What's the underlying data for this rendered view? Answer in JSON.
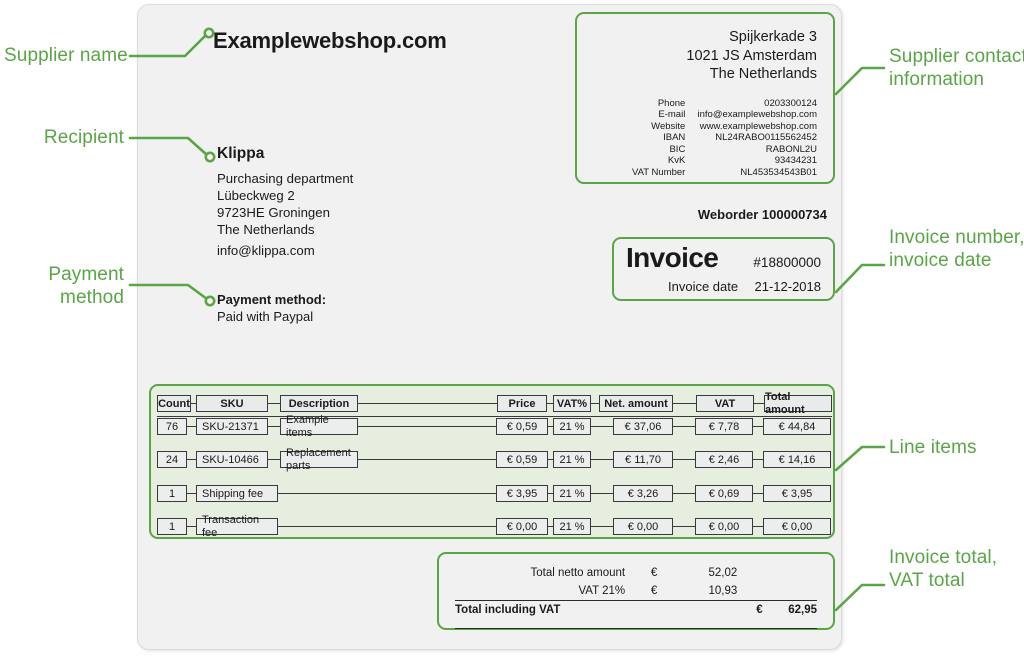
{
  "annotations": [
    {
      "id": "supplier-name",
      "text": "Supplier name",
      "side": "left"
    },
    {
      "id": "recipient",
      "text": "Recipient",
      "side": "left"
    },
    {
      "id": "payment-method",
      "text": "Payment\nmethod",
      "side": "left"
    },
    {
      "id": "supplier-contact",
      "text": "Supplier contact\ninformation",
      "side": "right"
    },
    {
      "id": "invoice-number",
      "text": "Invoice number,\ninvoice date",
      "side": "right"
    },
    {
      "id": "line-items",
      "text": "Line items",
      "side": "right"
    },
    {
      "id": "invoice-total",
      "text": "Invoice total,\nVAT total",
      "side": "right"
    }
  ],
  "annotation_labels": {
    "supplier_name": "Supplier name",
    "recipient": "Recipient",
    "payment_method_l1": "Payment",
    "payment_method_l2": "method",
    "supplier_contact_l1": "Supplier contact",
    "supplier_contact_l2": "information",
    "invoice_number_l1": "Invoice number,",
    "invoice_number_l2": "invoice date",
    "line_items": "Line items",
    "invoice_total_l1": "Invoice total,",
    "invoice_total_l2": "VAT total"
  },
  "colors": {
    "accent_green": "#5aa545",
    "page_bg": "#f1f1f1",
    "items_bg": "#e6eee0",
    "cell_bg": "#eceded",
    "text": "#1a1a1a"
  },
  "supplier": {
    "name": "Examplewebshop.com",
    "address": [
      "Spijkerkade 3",
      "1021 JS Amsterdam",
      "The Netherlands"
    ],
    "details": [
      {
        "label": "Phone",
        "value": "0203300124"
      },
      {
        "label": "E-mail",
        "value": "info@examplewebshop.com"
      },
      {
        "label": "Website",
        "value": "www.examplewebshop.com"
      },
      {
        "label": "IBAN",
        "value": "NL24RABO0115562452"
      },
      {
        "label": "BIC",
        "value": "RABONL2U"
      },
      {
        "label": "KvK",
        "value": "93434231"
      },
      {
        "label": "VAT Number",
        "value": "NL453534543B01"
      }
    ]
  },
  "recipient": {
    "name": "Klippa",
    "lines": [
      "Purchasing department",
      "Lübeckweg 2",
      "9723HE  Groningen",
      "The Netherlands"
    ],
    "email": "info@klippa.com"
  },
  "payment": {
    "heading": "Payment method:",
    "value": "Paid with Paypal"
  },
  "weborder": "Weborder 100000734",
  "invoice": {
    "title": "Invoice",
    "number": "#18800000",
    "date_label": "Invoice date",
    "date_value": "21-12-2018"
  },
  "items_table": {
    "headers": {
      "count": "Count",
      "sku": "SKU",
      "description": "Description",
      "price": "Price",
      "vat_pct": "VAT%",
      "net_amount": "Net. amount",
      "vat": "VAT",
      "total_amount": "Total amount"
    },
    "rows": [
      {
        "count": "76",
        "sku": "SKU-21371",
        "description": "Example items",
        "price": "€ 0,59",
        "vat_pct": "21 %",
        "net_amount": "€ 37,06",
        "vat": "€ 7,78",
        "total_amount": "€ 44,84"
      },
      {
        "count": "24",
        "sku": "SKU-10466",
        "description": "Replacement parts",
        "price": "€ 0,59",
        "vat_pct": "21 %",
        "net_amount": "€ 11,70",
        "vat": "€ 2,46",
        "total_amount": "€ 14,16"
      },
      {
        "count": "1",
        "sku": "Shipping fee",
        "description": "",
        "price": "€ 3,95",
        "vat_pct": "21 %",
        "net_amount": "€  3,26",
        "vat": "€ 0,69",
        "total_amount": "€  3,95"
      },
      {
        "count": "1",
        "sku": "Transaction fee",
        "description": "",
        "price": "€ 0,00",
        "vat_pct": "21 %",
        "net_amount": "€  0,00",
        "vat": "€ 0,00",
        "total_amount": "€  0,00"
      }
    ]
  },
  "totals": {
    "netto_label": "Total netto amount",
    "netto_currency": "€",
    "netto_value": "52,02",
    "vat_label": "VAT 21%",
    "vat_currency": "€",
    "vat_value": "10,93",
    "total_label": "Total including VAT",
    "total_currency": "€",
    "total_value": "62,95"
  }
}
